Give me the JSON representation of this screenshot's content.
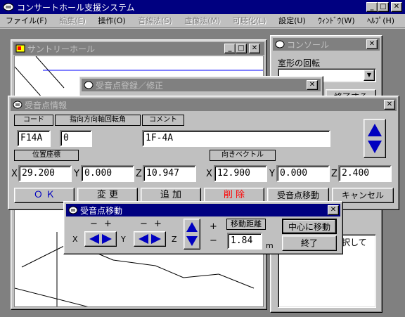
{
  "app": {
    "title": "コンサートホール支援システム"
  },
  "menu": [
    {
      "label": "ファイル(F)",
      "enabled": true
    },
    {
      "label": "編集(E)",
      "enabled": false
    },
    {
      "label": "操作(O)",
      "enabled": true
    },
    {
      "label": "音線法(S)",
      "enabled": false
    },
    {
      "label": "虚像法(M)",
      "enabled": false
    },
    {
      "label": "可聴化(L)",
      "enabled": false
    },
    {
      "label": "設定(U)",
      "enabled": true
    },
    {
      "label": "ｳｨﾝﾄﾞｳ(W)",
      "enabled": true
    },
    {
      "label": "ﾍﾙﾌﾟ(H)",
      "enabled": true
    }
  ],
  "suntory": {
    "title": "サントリーホール"
  },
  "console": {
    "title": "コンソール",
    "rotation_label": "室形の回転",
    "partial_button": "終了する",
    "partial_text": "択して"
  },
  "registration": {
    "title": "受音点登録／修正"
  },
  "info": {
    "title": "受音点情報",
    "code_label": "コード",
    "rotation_label": "指向方向軸回転角",
    "comment_label": "コメント",
    "code_value": "F14A",
    "rotation_value": "0",
    "comment_value": "1F-4A",
    "position_label": "位置座標",
    "vector_label": "向きベクトル",
    "x_label": "X",
    "y_label": "Y",
    "z_label": "Z",
    "pos_x": "29.200",
    "pos_y": "0.000",
    "pos_z": "10.947",
    "vec_x": "12.900",
    "vec_y": "0.000",
    "vec_z": "2.400",
    "buttons": {
      "ok": "Ｏ Ｋ",
      "change": "変 更",
      "add": "追 加",
      "delete": "削 除",
      "move": "受音点移動",
      "cancel": "キャンセル"
    }
  },
  "move": {
    "title": "受音点移動",
    "minus": "−",
    "plus": "+",
    "x_label": "X",
    "y_label": "Y",
    "z_label": "Z",
    "distance_label": "移動距離",
    "distance_value": "1.84",
    "unit": "m",
    "center_button": "中心に移動",
    "end_button": "終了"
  },
  "colors": {
    "title_active": "#000080",
    "title_inactive": "#808080",
    "delete_red": "#ff0000"
  }
}
